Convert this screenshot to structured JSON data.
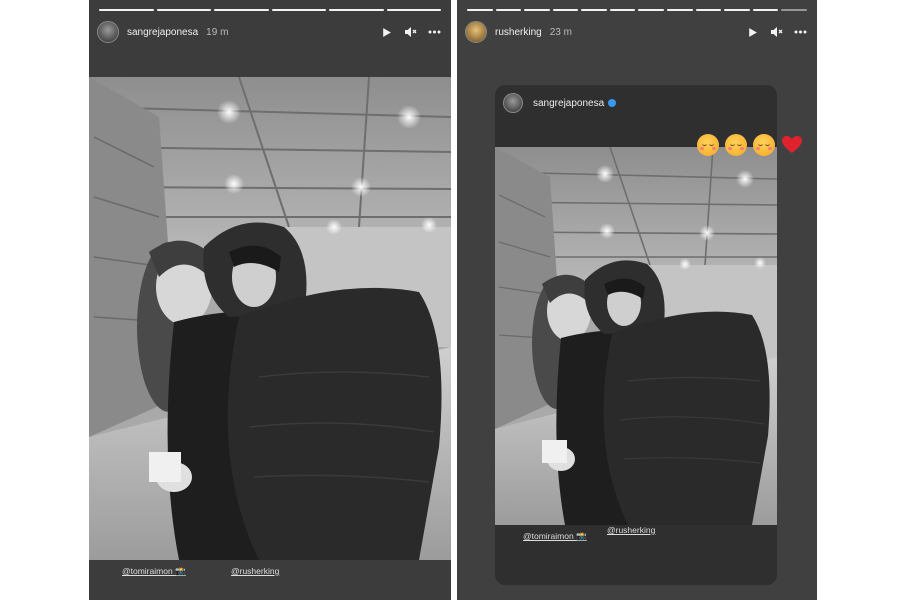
{
  "left_story": {
    "username": "sangrejaponesa",
    "time": "19 m",
    "progress": {
      "segments": 6,
      "completed": 6
    },
    "mentions": [
      "@tomiraimon 📸",
      "@rusherking"
    ],
    "icons": [
      "play-icon",
      "mute-icon",
      "more-icon"
    ]
  },
  "right_story": {
    "username": "rusherking",
    "time": "23 m",
    "progress": {
      "segments": 12,
      "completed": 11
    },
    "icons": [
      "play-icon",
      "mute-icon",
      "more-icon"
    ],
    "shared_post": {
      "username": "sangrejaponesa",
      "verified": true,
      "mentions": [
        "@tomiraimon 📸",
        "@rusherking"
      ]
    },
    "stickers": [
      "smiling-face-with-hearts",
      "smiling-face-with-hearts",
      "smiling-face-with-hearts",
      "red-heart"
    ]
  },
  "colors": {
    "story_bg": "#3c3c3c",
    "verified": "#3897f0",
    "heart": "#e0222f"
  }
}
